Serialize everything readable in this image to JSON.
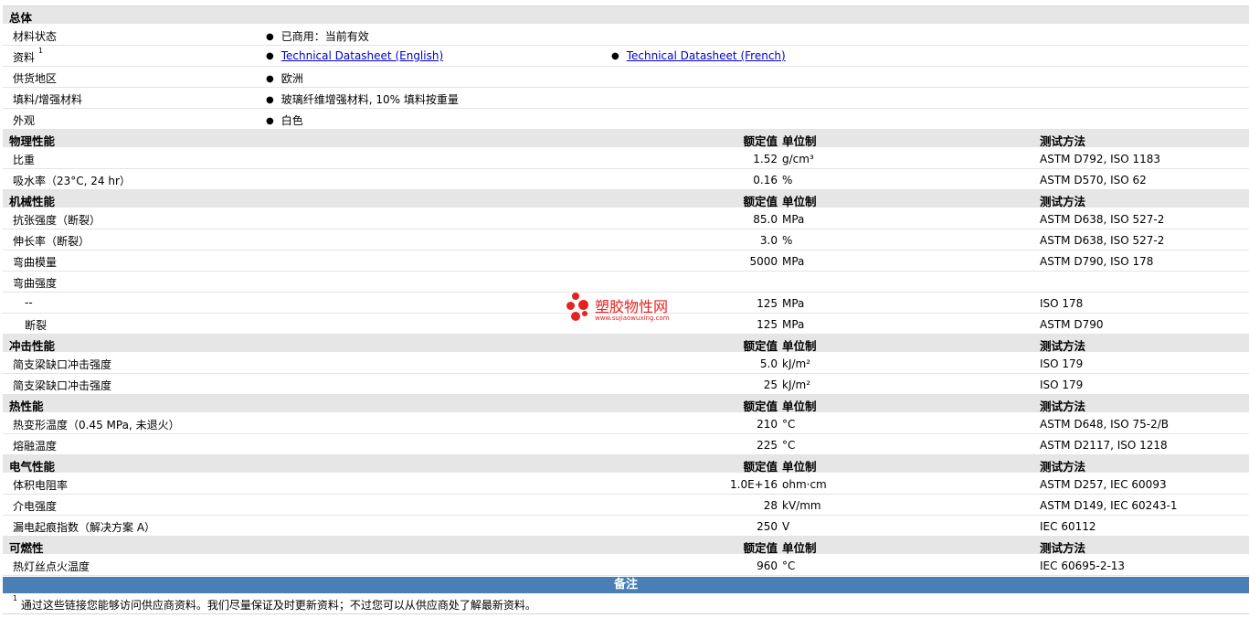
{
  "general": {
    "title": "总体",
    "rows": [
      {
        "label": "材料状态",
        "items": [
          "已商用：当前有效"
        ]
      },
      {
        "label": "资料",
        "sup": "1",
        "links": [
          "Technical Datasheet (English)",
          "Technical Datasheet (French)"
        ]
      },
      {
        "label": "供货地区",
        "items": [
          "欧洲"
        ]
      },
      {
        "label": "填料/增强材料",
        "items": [
          "玻璃纤维增强材料, 10% 填料按重量"
        ]
      },
      {
        "label": "外观",
        "items": [
          "白色"
        ]
      }
    ]
  },
  "headers": {
    "value": "额定值",
    "unit": "单位制",
    "method": "测试方法"
  },
  "sections": [
    {
      "title": "物理性能",
      "rows": [
        {
          "label": "比重",
          "value": "1.52",
          "unit": "g/cm³",
          "method": "ASTM D792, ISO 1183"
        },
        {
          "label": "吸水率（23°C, 24 hr）",
          "value": "0.16",
          "unit": "%",
          "method": "ASTM D570, ISO 62"
        }
      ]
    },
    {
      "title": "机械性能",
      "rows": [
        {
          "label": "抗张强度（断裂）",
          "value": "85.0",
          "unit": "MPa",
          "method": "ASTM D638, ISO 527-2"
        },
        {
          "label": "伸长率（断裂）",
          "value": "3.0",
          "unit": "%",
          "method": "ASTM D638, ISO 527-2"
        },
        {
          "label": "弯曲模量",
          "value": "5000",
          "unit": "MPa",
          "method": "ASTM D790, ISO 178"
        },
        {
          "label": "弯曲强度",
          "value": "",
          "unit": "",
          "method": ""
        },
        {
          "label": "--",
          "value": "125",
          "unit": "MPa",
          "method": "ISO 178",
          "indent": true
        },
        {
          "label": "断裂",
          "value": "125",
          "unit": "MPa",
          "method": "ASTM D790",
          "indent": true
        }
      ]
    },
    {
      "title": "冲击性能",
      "rows": [
        {
          "label": "简支梁缺口冲击强度",
          "value": "5.0",
          "unit": "kJ/m²",
          "method": "ISO 179"
        },
        {
          "label": "简支梁缺口冲击强度",
          "value": "25",
          "unit": "kJ/m²",
          "method": "ISO 179"
        }
      ]
    },
    {
      "title": "热性能",
      "rows": [
        {
          "label": "热变形温度（0.45 MPa, 未退火）",
          "value": "210",
          "unit": "°C",
          "method": "ASTM D648, ISO 75-2/B"
        },
        {
          "label": "熔融温度",
          "value": "225",
          "unit": "°C",
          "method": "ASTM D2117, ISO 1218"
        }
      ]
    },
    {
      "title": "电气性能",
      "rows": [
        {
          "label": "体积电阻率",
          "value": "1.0E+16",
          "unit": "ohm·cm",
          "method": "ASTM D257, IEC 60093"
        },
        {
          "label": "介电强度",
          "value": "28",
          "unit": "kV/mm",
          "method": "ASTM D149, IEC 60243-1"
        },
        {
          "label": "漏电起痕指数（解决方案 A）",
          "value": "250",
          "unit": "V",
          "method": "IEC 60112"
        }
      ]
    },
    {
      "title": "可燃性",
      "rows": [
        {
          "label": "热灯丝点火温度",
          "value": "960",
          "unit": "°C",
          "method": "IEC 60695-2-13"
        }
      ]
    }
  ],
  "notes": {
    "title": "备注",
    "sup": "1",
    "text": "通过这些链接您能够访问供应商资料。我们尽量保证及时更新资料；不过您可以从供应商处了解最新资料。"
  },
  "watermark": {
    "name": "塑胶物性网",
    "url": "www.sujiaowuxing.com"
  },
  "colors": {
    "section_bg": "#e6e6e6",
    "notes_header_bg": "#4a7fb5",
    "link": "#0000cc",
    "watermark": "#e52222"
  }
}
